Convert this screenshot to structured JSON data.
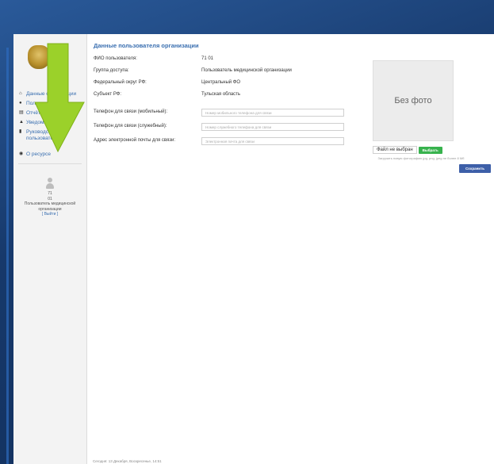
{
  "page": {
    "title": "Данные пользователя организации",
    "footer": "Сегодня: 13 Декабря, Воскресенье, 14:51"
  },
  "sidebar": {
    "items": [
      {
        "label": "Данные организации",
        "icon": "home-icon"
      },
      {
        "label": "Пользователь",
        "icon": "user-icon"
      },
      {
        "label": "Отчётные формы",
        "icon": "document-list-icon"
      },
      {
        "label": "Уведомления",
        "icon": "bell-icon"
      },
      {
        "label": "Руководство пользователя",
        "icon": "book-icon"
      }
    ],
    "about": {
      "label": "О ресурсе",
      "icon": "info-icon"
    }
  },
  "user": {
    "line1": "71",
    "line2": "01",
    "role": "Пользователь медицинской организации",
    "logout": "[ Выйти ]"
  },
  "fields": {
    "fio_label": "ФИО пользователя:",
    "fio_value": "71 01",
    "group_label": "Группа доступа:",
    "group_value": "Пользователь медицинской организации",
    "district_label": "Федеральный округ РФ:",
    "district_value": "Центральный ФО",
    "region_label": "Субъект РФ:",
    "region_value": "Тульская область",
    "mobile_label": "Телефон для связи (мобильный):",
    "mobile_placeholder": "Номер мобильного телефона для связи",
    "work_label": "Телефон для связи (служебный):",
    "work_placeholder": "Номер служебного телефона для связи",
    "email_label": "Адрес электронной почты для связи:",
    "email_placeholder": "Электронная почта для связи"
  },
  "photo": {
    "no_photo": "Без фото",
    "file_status": "Файл не выбран",
    "choose_button": "Выбрать",
    "hint": "Загрузить новую фотографию jpg, png, jpeg не более 8 Мб"
  },
  "actions": {
    "save": "Сохранить"
  },
  "colors": {
    "accent": "#3a6fb0",
    "background": "#1b3f73",
    "choose_button": "#37b24d",
    "save_button": "#3d5fa8",
    "arrow": "#9bd12a"
  }
}
